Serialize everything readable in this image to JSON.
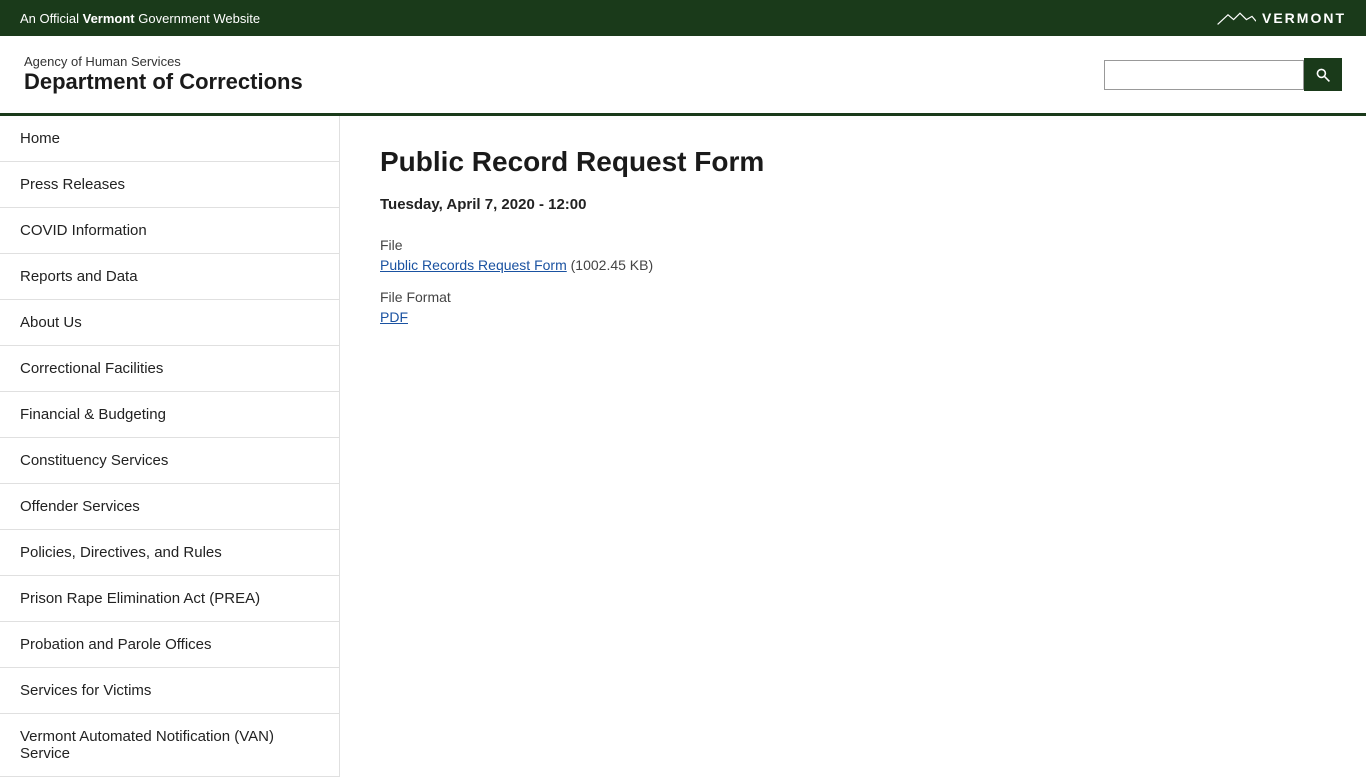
{
  "top_banner": {
    "official_text_prefix": "An Official ",
    "official_text_bold": "Vermont",
    "official_text_suffix": " Government Website",
    "vermont_label": "VERMONT"
  },
  "header": {
    "agency_name": "Agency of Human Services",
    "dept_name": "Department of Corrections",
    "search_placeholder": ""
  },
  "sidebar": {
    "items": [
      {
        "label": "Home"
      },
      {
        "label": "Press Releases"
      },
      {
        "label": "COVID Information"
      },
      {
        "label": "Reports and Data"
      },
      {
        "label": "About Us"
      },
      {
        "label": "Correctional Facilities"
      },
      {
        "label": "Financial & Budgeting"
      },
      {
        "label": "Constituency Services"
      },
      {
        "label": "Offender Services"
      },
      {
        "label": "Policies, Directives, and Rules"
      },
      {
        "label": "Prison Rape Elimination Act (PREA)"
      },
      {
        "label": "Probation and Parole Offices"
      },
      {
        "label": "Services for Victims"
      },
      {
        "label": "Vermont Automated Notification (VAN) Service"
      }
    ]
  },
  "main": {
    "page_title": "Public Record Request Form",
    "page_date": "Tuesday, April 7, 2020 - 12:00",
    "file_label": "File",
    "file_link_text": "Public Records Request Form",
    "file_size": "(1002.45 KB)",
    "file_format_label": "File Format",
    "file_format_value": "PDF"
  },
  "search": {
    "button_label": "Search"
  }
}
